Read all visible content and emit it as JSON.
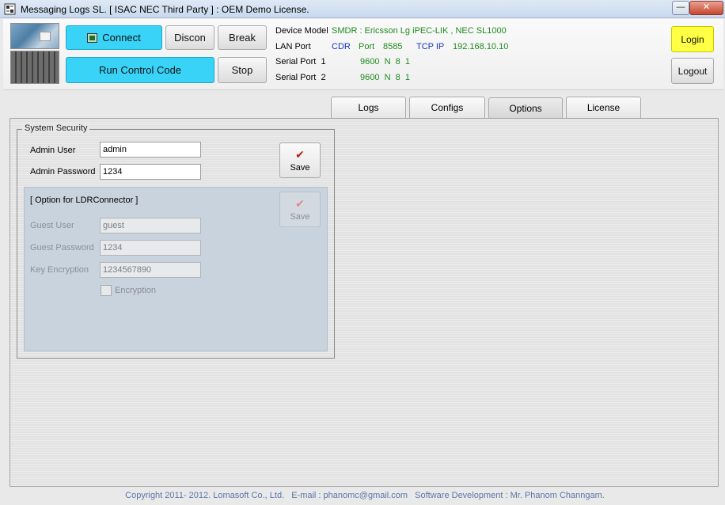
{
  "window": {
    "title": "Messaging Logs SL. [ ISAC NEC Third Party ] : OEM Demo License.",
    "minimize_label": "—",
    "close_label": "✕"
  },
  "toolbar": {
    "connect_label": "Connect",
    "discon_label": "Discon",
    "break_label": "Break",
    "run_label": "Run Control Code",
    "stop_label": "Stop",
    "login_label": "Login",
    "logout_label": "Logout"
  },
  "device_info": {
    "device_model_label": "Device Model",
    "device_model_value": "SMDR : Ericsson Lg iPEC-LIK , NEC SL1000",
    "lan_port_label": "LAN Port",
    "lan_cdr": "CDR",
    "lan_port_word": "Port",
    "lan_port_num": "8585",
    "lan_tcp_label": "TCP IP",
    "lan_ip": "192.168.10.10",
    "serial1_label": "Serial Port  1",
    "serial1_value": "9600  N  8  1",
    "serial2_label": "Serial Port  2",
    "serial2_value": "9600  N  8  1"
  },
  "tabs": [
    {
      "label": "Logs"
    },
    {
      "label": "Configs"
    },
    {
      "label": "Options"
    },
    {
      "label": "License"
    }
  ],
  "active_tab": "Options",
  "system_security": {
    "title": "System Security",
    "admin_user_label": "Admin User",
    "admin_user_value": "admin",
    "admin_password_label": "Admin Password",
    "admin_password_value": "1234",
    "save_label": "Save"
  },
  "ldr_option": {
    "title": "[ Option for LDRConnector ]",
    "save_label": "Save",
    "guest_user_label": "Guest User",
    "guest_user_value": "guest",
    "guest_password_label": "Guest Password",
    "guest_password_value": "1234",
    "key_encryption_label": "Key Encryption",
    "key_encryption_value": "1234567890",
    "encryption_label": "Encryption",
    "encryption_checked": false
  },
  "footer": {
    "copyright": "Copyright 2011- 2012. Lomasoft Co., Ltd.",
    "email": "E-mail : phanomc@gmail.com",
    "developer": "Software Development  :  Mr. Phanom Channgam."
  },
  "colors": {
    "accent_blue": "#38d3f7",
    "login_yellow": "#ffff44",
    "value_green": "#1f8a1f",
    "value_blue": "#1a33b8"
  }
}
